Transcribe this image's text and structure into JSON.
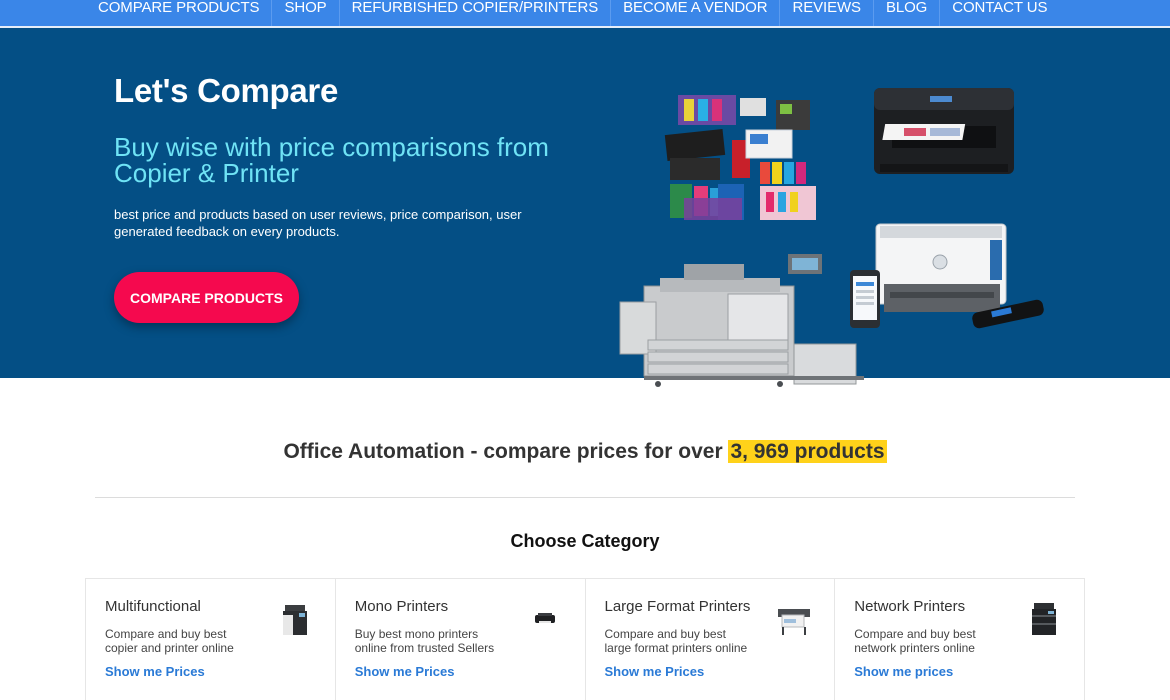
{
  "nav": {
    "items": [
      {
        "label": "COMPARE PRODUCTS"
      },
      {
        "label": "SHOP"
      },
      {
        "label": "REFURBISHED COPIER/PRINTERS"
      },
      {
        "label": "BECOME A VENDOR"
      },
      {
        "label": "REVIEWS"
      },
      {
        "label": "BLOG"
      },
      {
        "label": "CONTACT US"
      }
    ]
  },
  "hero": {
    "title": "Let's Compare",
    "subtitle": "Buy wise with price comparisons from Copier & Printer",
    "description": "best price and products based on user reviews, price comparison, user generated feedback on every products.",
    "button_label": "COMPARE PRODUCTS"
  },
  "headline": {
    "prefix": "Office Automation - compare prices for over ",
    "highlight": "3, 969 products"
  },
  "section": {
    "title": "Choose Category"
  },
  "categories": [
    {
      "name": "Multifunctional",
      "description": "Compare and buy best copier and printer online",
      "link": "Show me Prices",
      "icon": "multifunction-copier-icon"
    },
    {
      "name": "Mono Printers",
      "description": "Buy best mono printers online from trusted Sellers",
      "link": "Show me Prices",
      "icon": "mono-printer-icon"
    },
    {
      "name": "Large Format Printers",
      "description": "Compare and buy best large format printers online",
      "link": "Show me Prices",
      "icon": "large-format-printer-icon"
    },
    {
      "name": "Network Printers",
      "description": "Compare and buy best network printers online",
      "link": "Show me prices",
      "icon": "network-printer-icon"
    }
  ],
  "colors": {
    "nav_bg": "#3a86e8",
    "hero_bg": "#044f85",
    "subtitle": "#6fe3f5",
    "cta": "#f5094e",
    "highlight": "#ffd21a",
    "link": "#2a7ad6"
  }
}
